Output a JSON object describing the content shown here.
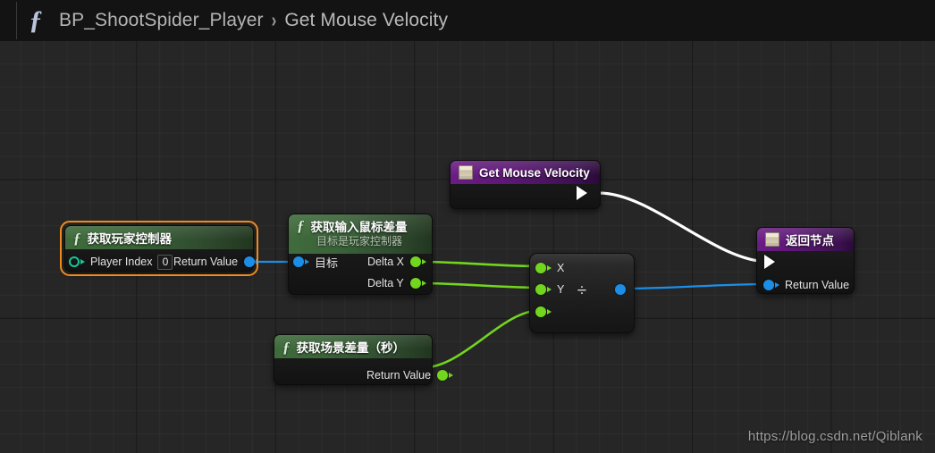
{
  "titlebar": {
    "function_icon": "fn-script-icon",
    "breadcrumb_root": "BP_ShootSpider_Player",
    "breadcrumb_separator": "›",
    "breadcrumb_leaf": "Get Mouse Velocity"
  },
  "colors": {
    "exec_wire": "#ffffff",
    "object_wire": "#1b8fe8",
    "float_wire": "#72d61f",
    "selection": "#f08a1e",
    "header_function": "#3f6b3c",
    "header_event": "#6a1c84",
    "canvas": "#262626"
  },
  "nodes": {
    "get_player_controller": {
      "title": "获取玩家控制器",
      "selected": true,
      "input_pin_label": "Player Index",
      "input_pin_value": "0",
      "output_pin_label": "Return Value"
    },
    "get_input_mouse_delta": {
      "title": "获取输入鼠标差量",
      "subtitle": "目标是玩家控制器",
      "target_pin_label": "目标",
      "out_x_label": "Delta X",
      "out_y_label": "Delta Y"
    },
    "get_mouse_velocity": {
      "title": "Get Mouse Velocity",
      "icon": "node-entry-icon"
    },
    "get_world_delta_seconds": {
      "title": "获取场景差量（秒）",
      "output_pin_label": "Return Value"
    },
    "divide": {
      "operator": "÷",
      "in_x_label": "X",
      "in_y_label": "Y",
      "in_extra_label": ""
    },
    "return_node": {
      "title": "返回节点",
      "icon": "node-return-icon",
      "return_value_label": "Return Value"
    }
  },
  "watermark": "https://blog.csdn.net/Qiblank"
}
